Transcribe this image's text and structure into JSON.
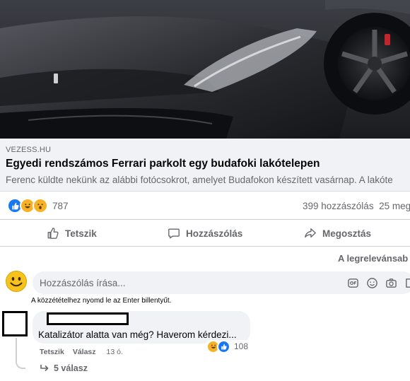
{
  "post": {
    "image": {
      "subject": "black Ferrari front view"
    },
    "preview": {
      "domain": "VEZESS.HU",
      "title": "Egyedi rendszámos Ferrari parkolt egy budafoki lakótelepen",
      "description": "Ferenc küldte nekünk az alábbi fotócsokrot, amelyet Budafokon készített vasárnap. A lakóte"
    },
    "reactions": {
      "icons": [
        "like-icon",
        "haha-icon",
        "wow-icon"
      ],
      "count": "787"
    },
    "comment_count": "399 hozzászólás",
    "share_count": "25 meg"
  },
  "actions": {
    "like": "Tetszik",
    "comment": "Hozzászólás",
    "share": "Megosztás"
  },
  "sort_label": "A legrelevánsab",
  "comment_input": {
    "placeholder": "Hozzászólás írása...",
    "hint": "A közzétételhez nyomd le az Enter billentyűt.",
    "icons": [
      "gif-icon",
      "emoji-icon",
      "camera-icon",
      "sticker-icon"
    ]
  },
  "comment": {
    "text": "Katalizátor alatta van még? Haverom kérdezi...",
    "reactions": {
      "icons": [
        "haha-icon",
        "like-icon"
      ],
      "count": "108"
    },
    "like_label": "Tetszik",
    "reply_label": "Válasz",
    "time": "13 ó.",
    "replies_label": "5 válasz"
  },
  "colors": {
    "secondary_text": "#65676b",
    "like_blue": "#1877f2",
    "bubble_bg": "#f0f2f5"
  }
}
